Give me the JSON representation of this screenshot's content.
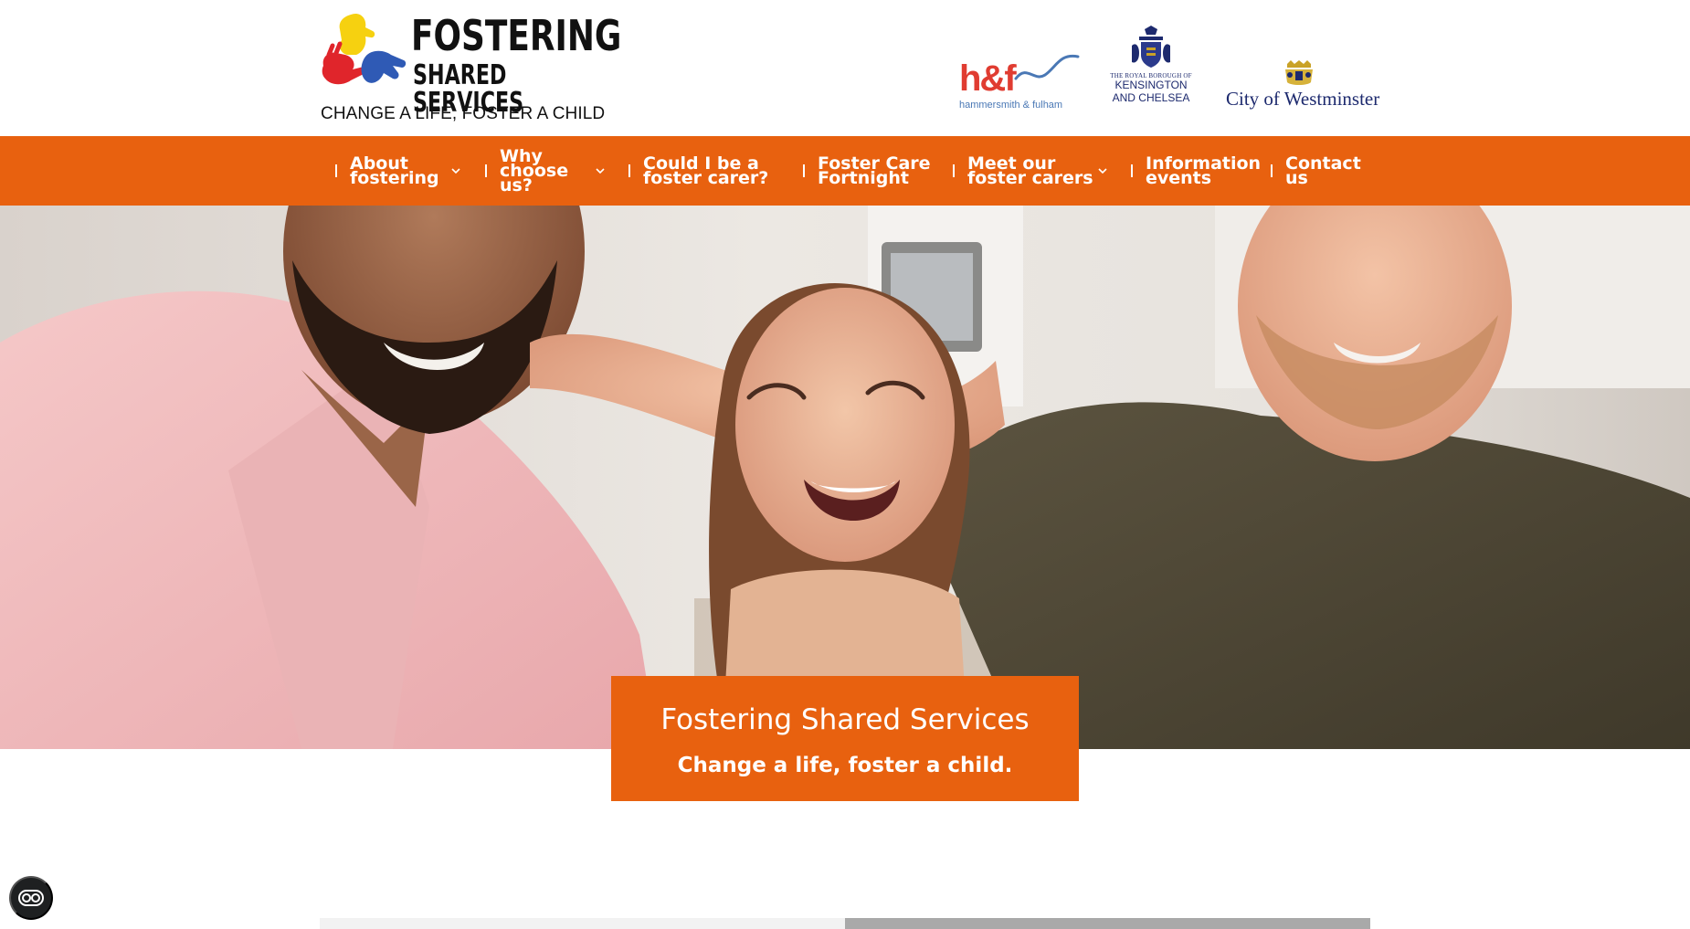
{
  "brand": {
    "logo_line1": "FOSTERING",
    "logo_line2": "SHARED SERVICES",
    "tagline": "CHANGE A LIFE, FOSTER A CHILD",
    "colors": {
      "orange": "#e8610f",
      "yellow": "#f6d110",
      "red": "#e0252b",
      "blue": "#2f5ab5",
      "navy": "#1d2a6e"
    }
  },
  "partners": {
    "hf": {
      "mark": "h&f",
      "sub": "hammersmith & fulham"
    },
    "kc": {
      "line1": "THE ROYAL BOROUGH OF",
      "line2": "KENSINGTON",
      "line3": "AND CHELSEA"
    },
    "wm": {
      "text": "City of Westminster"
    }
  },
  "nav": {
    "items": [
      {
        "label": "About\nfostering",
        "has_dropdown": true
      },
      {
        "label": "Why\nchoose\nus?",
        "has_dropdown": true
      },
      {
        "label": "Could I be a\nfoster carer?",
        "has_dropdown": false
      },
      {
        "label": "Foster Care\nFortnight",
        "has_dropdown": false
      },
      {
        "label": "Meet our\nfoster carers",
        "has_dropdown": true
      },
      {
        "label": "Information\nevents",
        "has_dropdown": false
      },
      {
        "label": "Contact\nus",
        "has_dropdown": false
      }
    ],
    "caret_icon": "chevron-down-icon"
  },
  "hero": {
    "title": "Fostering Shared Services",
    "subtitle": "Change a life, foster a child."
  },
  "accessibility": {
    "icon": "accessibility-toggle-icon"
  }
}
